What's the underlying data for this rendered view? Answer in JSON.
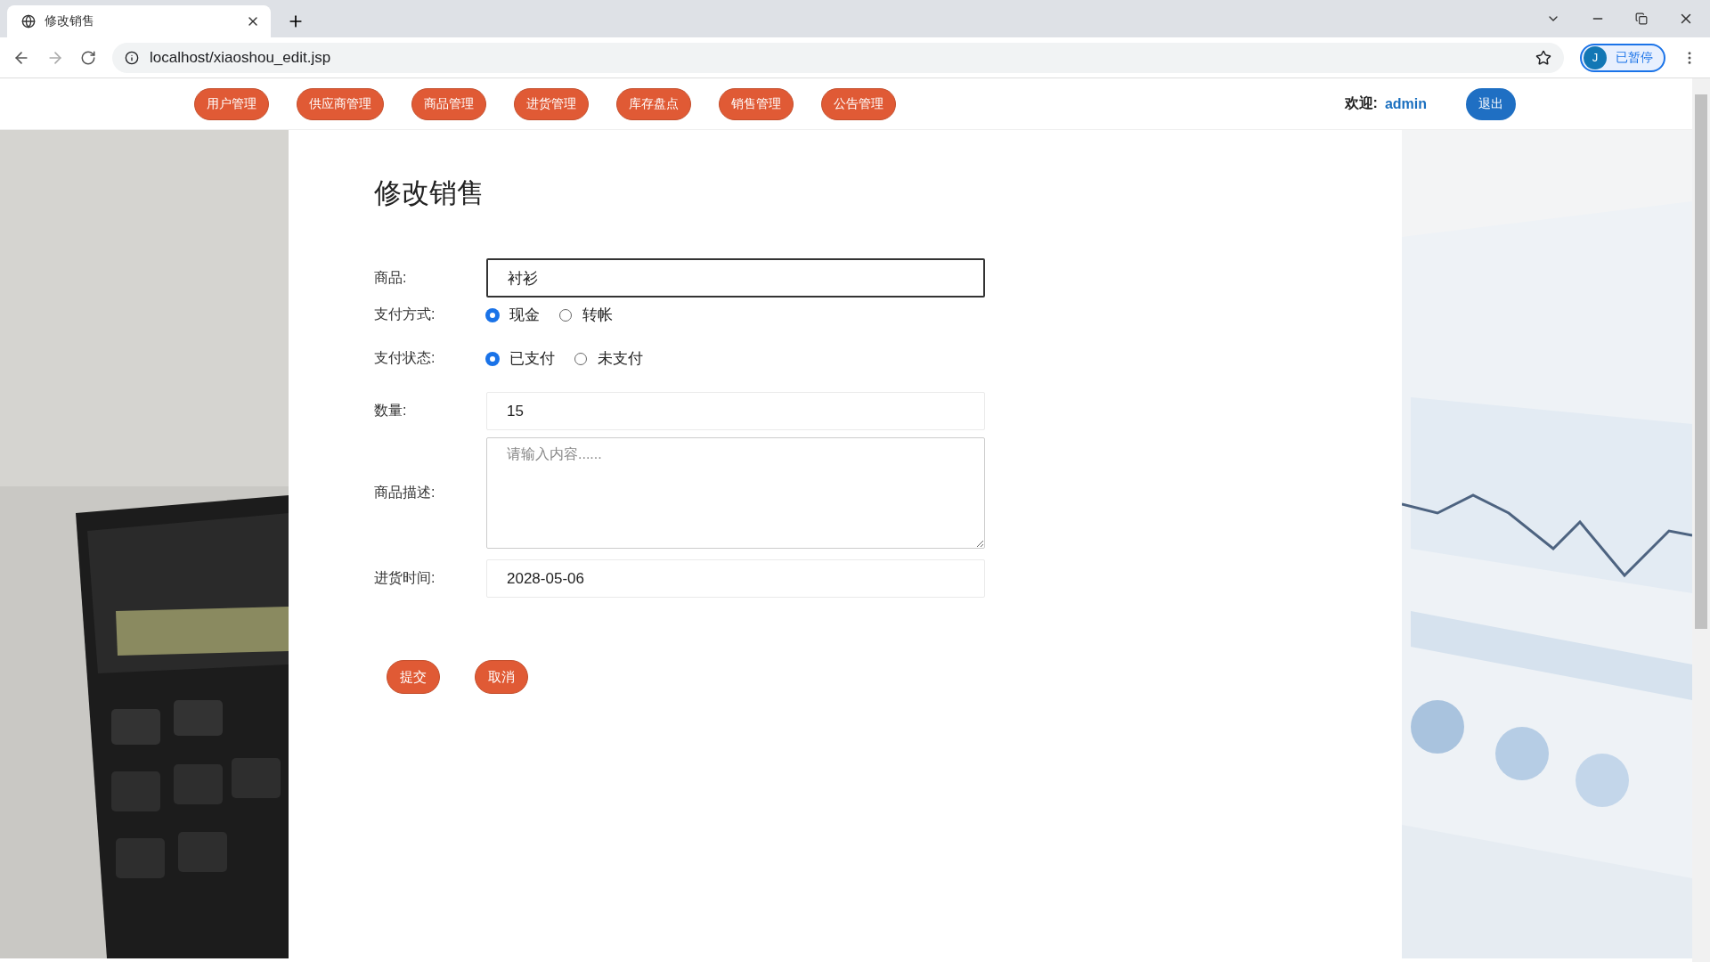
{
  "browser": {
    "tab_title": "修改销售",
    "url": "localhost/xiaoshou_edit.jsp",
    "profile_initial": "J",
    "profile_status": "已暂停"
  },
  "nav": {
    "items": [
      "用户管理",
      "供应商管理",
      "商品管理",
      "进货管理",
      "库存盘点",
      "销售管理",
      "公告管理"
    ],
    "welcome": "欢迎:",
    "user": "admin",
    "logout": "退出"
  },
  "form": {
    "title": "修改销售",
    "fields": [
      {
        "kind": "text",
        "label": "商品:",
        "value": "衬衫",
        "focused": true
      },
      {
        "kind": "radio",
        "label": "支付方式:",
        "options": [
          {
            "label": "现金",
            "selected": true
          },
          {
            "label": "转帐",
            "selected": false
          }
        ]
      },
      {
        "kind": "radio",
        "label": "支付状态:",
        "options": [
          {
            "label": "已支付",
            "selected": true
          },
          {
            "label": "未支付",
            "selected": false
          }
        ]
      },
      {
        "kind": "text",
        "label": "数量:",
        "value": "15",
        "focused": false
      },
      {
        "kind": "textarea",
        "label": "商品描述:",
        "placeholder": "请输入内容......"
      },
      {
        "kind": "text",
        "label": "进货时间:",
        "value": "2028-05-06",
        "focused": false
      }
    ],
    "buttons": [
      "提交",
      "取消"
    ]
  }
}
